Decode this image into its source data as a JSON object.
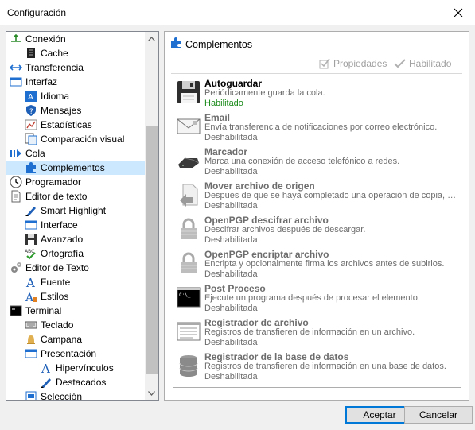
{
  "window": {
    "title": "Configuración"
  },
  "tree": {
    "items": [
      {
        "label": "Conexión",
        "icon": "connection-icon"
      },
      {
        "label": "Cache",
        "icon": "cache-icon"
      },
      {
        "label": "Transferencia",
        "icon": "transfer-icon"
      },
      {
        "label": "Interfaz",
        "icon": "interface-icon"
      },
      {
        "label": "Idioma",
        "icon": "language-icon"
      },
      {
        "label": "Mensajes",
        "icon": "messages-icon"
      },
      {
        "label": "Estadísticas",
        "icon": "statistics-icon"
      },
      {
        "label": "Comparación visual",
        "icon": "visual-compare-icon"
      },
      {
        "label": "Cola",
        "icon": "queue-icon"
      },
      {
        "label": "Complementos",
        "icon": "plugin-icon"
      },
      {
        "label": "Programador",
        "icon": "scheduler-icon"
      },
      {
        "label": "Editor de texto",
        "icon": "text-editor-icon"
      },
      {
        "label": "Smart Highlight",
        "icon": "highlight-icon"
      },
      {
        "label": "Interface",
        "icon": "editor-interface-icon"
      },
      {
        "label": "Avanzado",
        "icon": "save-icon"
      },
      {
        "label": "Ortografía",
        "icon": "spelling-icon"
      },
      {
        "label": "Editor de Texto",
        "icon": "gears-icon"
      },
      {
        "label": "Fuente",
        "icon": "font-icon"
      },
      {
        "label": "Estilos",
        "icon": "styles-icon"
      },
      {
        "label": "Terminal",
        "icon": "terminal-icon"
      },
      {
        "label": "Teclado",
        "icon": "keyboard-icon"
      },
      {
        "label": "Campana",
        "icon": "bell-icon"
      },
      {
        "label": "Presentación",
        "icon": "presentation-icon"
      },
      {
        "label": "Hipervínculos",
        "icon": "hyperlink-icon"
      },
      {
        "label": "Destacados",
        "icon": "pen-icon"
      },
      {
        "label": "Selección",
        "icon": "selection-icon"
      }
    ]
  },
  "panel": {
    "title": "Complementos",
    "properties_label": "Propiedades",
    "enabled_label": "Habilitado"
  },
  "plugins": [
    {
      "name": "Autoguardar",
      "desc": "Periódicamente guarda la cola.",
      "state": "Habilitado",
      "icon": "floppy-icon"
    },
    {
      "name": "Email",
      "desc": "Envía transferencia de notificaciones por correo electrónico.",
      "state": "Deshabilitada",
      "icon": "email-icon"
    },
    {
      "name": "Marcador",
      "desc": "Marca una conexión de acceso telefónico a redes.",
      "state": "Deshabilitada",
      "icon": "modem-icon"
    },
    {
      "name": "Mover archivo de origen",
      "desc": "Después de que se haya completado una operación de copia, e…",
      "state": "Deshabilitada",
      "icon": "move-file-icon"
    },
    {
      "name": "OpenPGP descifrar archivo",
      "desc": "Descifrar archivos después de descargar.",
      "state": "Deshabilitada",
      "icon": "lock-icon"
    },
    {
      "name": "OpenPGP encriptar archivo",
      "desc": "Encripta y opcionalmente firma los archivos antes de subirlos.",
      "state": "Deshabilitada",
      "icon": "lock-icon"
    },
    {
      "name": "Post Proceso",
      "desc": "Ejecute un programa después de procesar el elemento.",
      "state": "Deshabilitada",
      "icon": "console-icon"
    },
    {
      "name": "Registrador de archivo",
      "desc": "Registros de transfieren de información en un archivo.",
      "state": "Deshabilitada",
      "icon": "log-file-icon"
    },
    {
      "name": "Registrador de la base de datos",
      "desc": "Registros de transfieren de información en una base de datos.",
      "state": "Deshabilitada",
      "icon": "database-icon"
    }
  ],
  "buttons": {
    "ok": "Aceptar",
    "cancel": "Cancelar"
  },
  "colors": {
    "selection": "#cce8ff",
    "enabled": "#1a8a1a",
    "accent": "#0078d7"
  }
}
